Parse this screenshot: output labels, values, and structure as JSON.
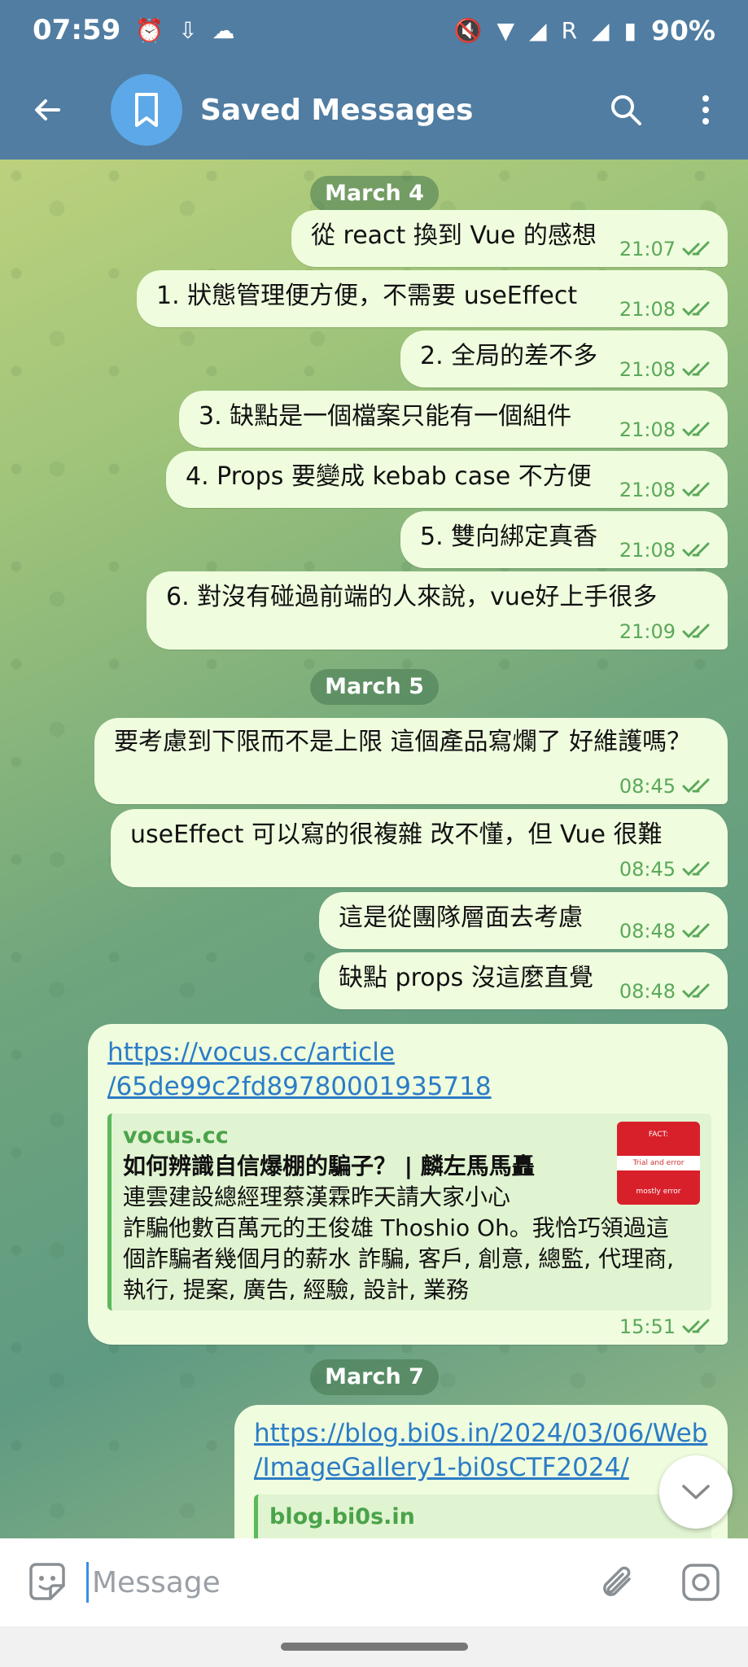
{
  "status_bar": {
    "time": "07:59",
    "battery": "90%",
    "signal_label": "R"
  },
  "header": {
    "title": "Saved Messages"
  },
  "dates": [
    "March 4",
    "March 5",
    "March 7"
  ],
  "messages": [
    {
      "text": "從 react 換到 Vue 的感想",
      "time": "21:07"
    },
    {
      "text": "1. 狀態管理便方便，不需要 useEffect",
      "time": "21:08"
    },
    {
      "text": "2. 全局的差不多",
      "time": "21:08"
    },
    {
      "text": "3. 缺點是一個檔案只能有一個組件",
      "time": "21:08"
    },
    {
      "text": "4. Props 要變成 kebab case 不方便",
      "time": "21:08"
    },
    {
      "text": "5. 雙向綁定真香",
      "time": "21:08"
    },
    {
      "text": "6. 對沒有碰過前端的人來說，vue好上手很多",
      "time": "21:09"
    },
    {
      "text": "要考慮到下限而不是上限 這個產品寫爛了 好維護嗎？",
      "time": "08:45"
    },
    {
      "text": "useEffect 可以寫的很複雜 改不懂，但 Vue 很難",
      "time": "08:45"
    },
    {
      "text": "這是從團隊層面去考慮",
      "time": "08:48"
    },
    {
      "text": "缺點 props 沒這麼直覺",
      "time": "08:48"
    }
  ],
  "link_message_1": {
    "url_line1": "https://vocus.cc/article",
    "url_line2": "/65de99c2fd89780001935718",
    "site": "vocus.cc",
    "title": "如何辨識自信爆棚的騙子？ | 麟左馬馬矗",
    "desc_line1": "連雲建設總經理蔡漢霖昨天請大家小心",
    "desc_line2": "詐騙他數百萬元的王俊雄 Thoshio Oh。我恰巧領過這",
    "desc_line3": "個詐騙者幾個月的薪水 詐騙, 客戶, 創意, 總監, 代理商,",
    "desc_line4": "執行, 提案, 廣告, 經驗, 設計, 業務",
    "thumb_top": "FACT:",
    "thumb_mid": "Trial and error",
    "thumb_bottom": "mostly error",
    "time": "15:51"
  },
  "link_message_2": {
    "url_line1": "https://blog.bi0s.in/2024/03/06/Web",
    "url_line2": "/ImageGallery1-bi0sCTF2024/",
    "site": "blog.bi0s.in"
  },
  "input": {
    "placeholder": "Message"
  }
}
